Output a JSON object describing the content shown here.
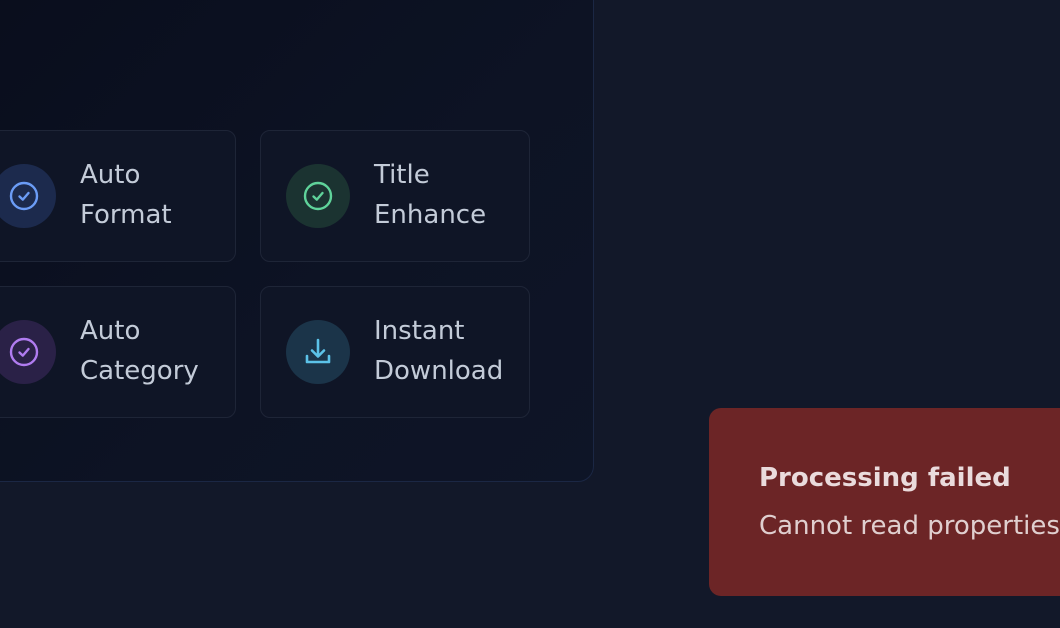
{
  "features": [
    {
      "label_line1": "Auto",
      "label_line2": "Format",
      "icon": "check-circle-icon",
      "icon_color": "#6b9cf6",
      "icon_bg": "#1c2a4d"
    },
    {
      "label_line1": "Title",
      "label_line2": "Enhance",
      "icon": "check-circle-icon",
      "icon_color": "#5fd39a",
      "icon_bg": "#1b3331"
    },
    {
      "label_line1": "Auto",
      "label_line2": "Category",
      "icon": "check-circle-icon",
      "icon_color": "#b07cf0",
      "icon_bg": "#2a2147"
    },
    {
      "label_line1": "Instant",
      "label_line2": "Download",
      "icon": "download-icon",
      "icon_color": "#5cc2e8",
      "icon_bg": "#1b3449"
    }
  ],
  "toast": {
    "title": "Processing failed",
    "message": "Cannot read properties",
    "background": "#6c2526"
  }
}
